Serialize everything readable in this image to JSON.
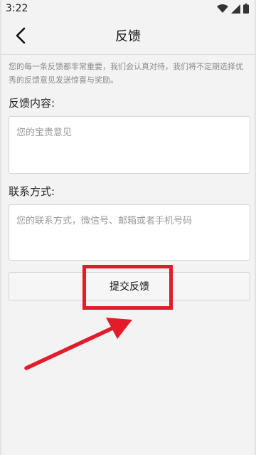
{
  "status_bar": {
    "time": "3:22",
    "icons": [
      "wifi-icon",
      "signal-icon",
      "battery-icon"
    ]
  },
  "nav": {
    "back_icon": "chevron-left-icon",
    "title": "反馈"
  },
  "intro": {
    "text": "您的每一条反馈都非常重要，我们会认真对待，我们将不定期选择优秀的反馈意见发送惊喜与奖励。"
  },
  "feedback": {
    "label": "反馈内容:",
    "placeholder": "您的宝贵意见"
  },
  "contact": {
    "label": "联系方式:",
    "placeholder": "您的联系方式，微信号、邮箱或者手机号码"
  },
  "submit": {
    "label": "提交反馈"
  },
  "annotation": {
    "color": "#e21c2b"
  }
}
